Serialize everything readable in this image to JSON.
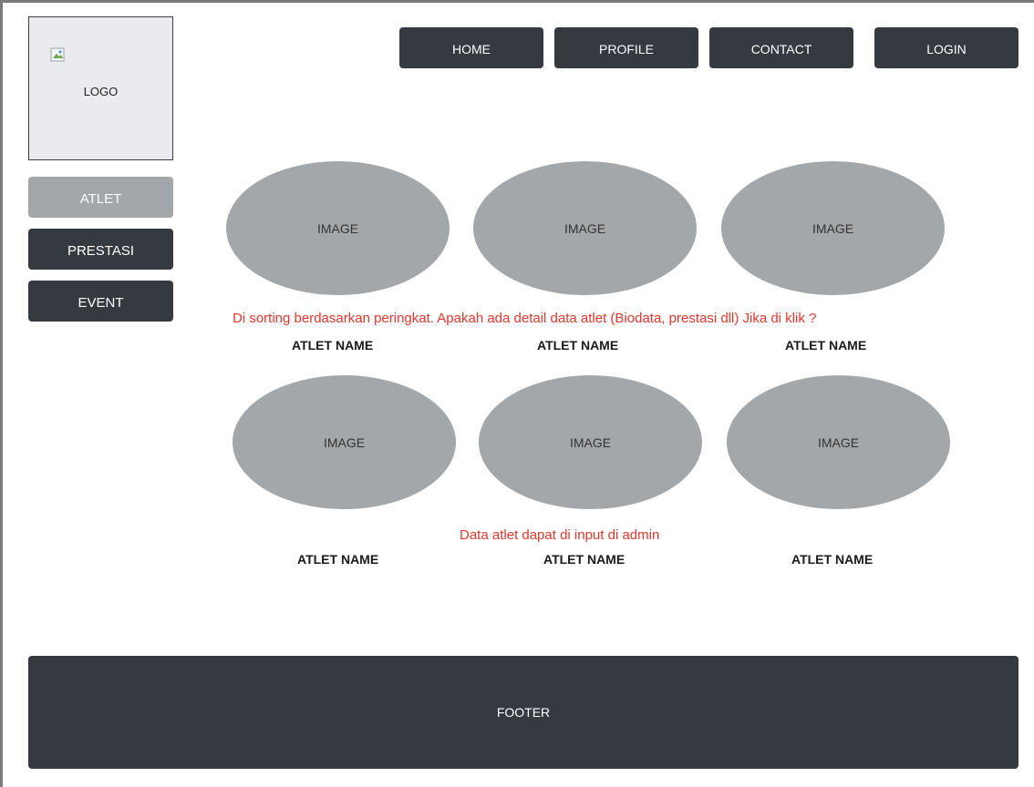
{
  "logo": {
    "text": "LOGO",
    "icon": "broken-image-icon"
  },
  "nav": {
    "home": "HOME",
    "profile": "PROFILE",
    "contact": "CONTACT",
    "login": "LOGIN"
  },
  "sidebar": {
    "items": [
      {
        "label": "ATLET",
        "active": true
      },
      {
        "label": "PRESTASI",
        "active": false
      },
      {
        "label": "EVENT",
        "active": false
      }
    ]
  },
  "athletes": [
    {
      "image": "IMAGE",
      "name": "ATLET NAME"
    },
    {
      "image": "IMAGE",
      "name": "ATLET NAME"
    },
    {
      "image": "IMAGE",
      "name": "ATLET NAME"
    },
    {
      "image": "IMAGE",
      "name": "ATLET NAME"
    },
    {
      "image": "IMAGE",
      "name": "ATLET NAME"
    },
    {
      "image": "IMAGE",
      "name": "ATLET NAME"
    }
  ],
  "notes": {
    "sorting": "Di sorting berdasarkan peringkat. Apakah ada detail data atlet (Biodata, prestasi dll) Jika di klik ?",
    "admin_input": "Data atlet dapat di input di admin"
  },
  "footer": {
    "text": "FOOTER"
  },
  "colors": {
    "dark": "#353940",
    "gray": "#a4a7aa",
    "note": "#e8362c"
  }
}
